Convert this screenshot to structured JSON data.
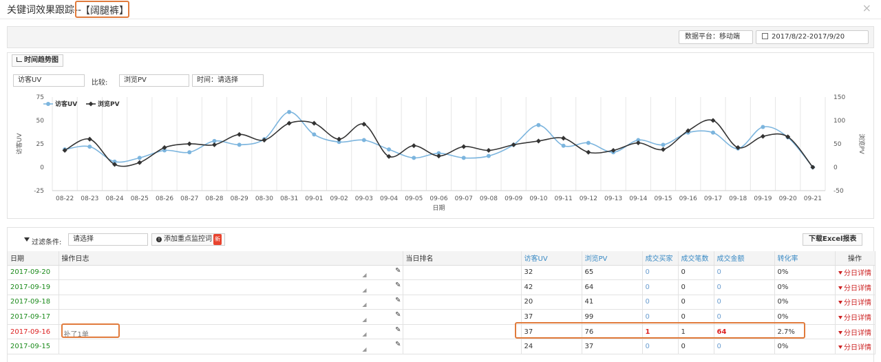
{
  "window": {
    "title": "关键词效果跟踪--",
    "keyword": "【阔腿裤】",
    "close_glyph": "×"
  },
  "toolbar": {
    "platform_label": "数据平台：移动端",
    "date_range": "2017/8/22-2017/9/20"
  },
  "chart_panel": {
    "tab_label": "时间趋势图",
    "metric1": "访客UV",
    "compare_label": "比较:",
    "metric2": "浏览PV",
    "time_select": "时间：请选择"
  },
  "chart_data": {
    "type": "line",
    "xlabel": "日期",
    "ylabel_left": "访客UV",
    "ylabel_right": "浏览PV",
    "ylim_left": [
      -25,
      75
    ],
    "yticks_left": [
      -25,
      0,
      25,
      50,
      75
    ],
    "ylim_right": [
      -50,
      150
    ],
    "yticks_right": [
      -50,
      0,
      50,
      100,
      150
    ],
    "legend_position": "top-left",
    "grid": "vertical",
    "categories": [
      "08-22",
      "08-23",
      "08-24",
      "08-25",
      "08-26",
      "08-27",
      "08-28",
      "08-29",
      "08-30",
      "08-31",
      "09-01",
      "09-02",
      "09-03",
      "09-04",
      "09-05",
      "09-06",
      "09-07",
      "09-08",
      "09-09",
      "09-10",
      "09-11",
      "09-12",
      "09-13",
      "09-14",
      "09-15",
      "09-16",
      "09-17",
      "09-18",
      "09-19",
      "09-20",
      "09-21"
    ],
    "series": [
      {
        "name": "访客UV",
        "axis": "left",
        "color": "#7cb5de",
        "values": [
          19,
          22,
          6,
          10,
          18,
          16,
          28,
          24,
          30,
          59,
          35,
          27,
          29,
          19,
          10,
          15,
          10,
          12,
          24,
          45,
          23,
          26,
          16,
          29,
          24,
          37,
          37,
          20,
          43,
          32,
          0
        ]
      },
      {
        "name": "浏览PV",
        "axis": "right",
        "color": "#333333",
        "values": [
          36,
          60,
          6,
          10,
          42,
          50,
          48,
          70,
          58,
          94,
          94,
          60,
          92,
          23,
          46,
          24,
          44,
          36,
          48,
          56,
          62,
          32,
          36,
          52,
          38,
          78,
          100,
          42,
          66,
          65,
          0
        ]
      }
    ]
  },
  "filters": {
    "label": "过滤条件:",
    "input_value": "请选择",
    "add_button": "添加重点监控词",
    "new_badge": "新",
    "export_button": "下载Excel报表"
  },
  "table": {
    "headers": [
      "日期",
      "操作日志",
      "当日排名",
      "访客UV",
      "浏览PV",
      "成交买家",
      "成交笔数",
      "成交金额",
      "转化率",
      "操作"
    ],
    "detail_label": "分日详情",
    "rows": [
      {
        "date": "2017-09-20",
        "log": "",
        "uv": "32",
        "pv": "65",
        "buyers": "0",
        "orders": "0",
        "amount": "0",
        "cvr": "0%"
      },
      {
        "date": "2017-09-19",
        "log": "",
        "uv": "42",
        "pv": "64",
        "buyers": "0",
        "orders": "0",
        "amount": "0",
        "cvr": "0%"
      },
      {
        "date": "2017-09-18",
        "log": "",
        "uv": "20",
        "pv": "41",
        "buyers": "0",
        "orders": "0",
        "amount": "0",
        "cvr": "0%"
      },
      {
        "date": "2017-09-17",
        "log": "",
        "uv": "37",
        "pv": "99",
        "buyers": "0",
        "orders": "0",
        "amount": "0",
        "cvr": "0%"
      },
      {
        "date": "2017-09-16",
        "log": "补了1单",
        "uv": "37",
        "pv": "76",
        "buyers": "1",
        "orders": "1",
        "amount": "64",
        "cvr": "2.7%"
      },
      {
        "date": "2017-09-15",
        "log": "",
        "uv": "24",
        "pv": "37",
        "buyers": "0",
        "orders": "0",
        "amount": "0",
        "cvr": "0%"
      }
    ]
  }
}
